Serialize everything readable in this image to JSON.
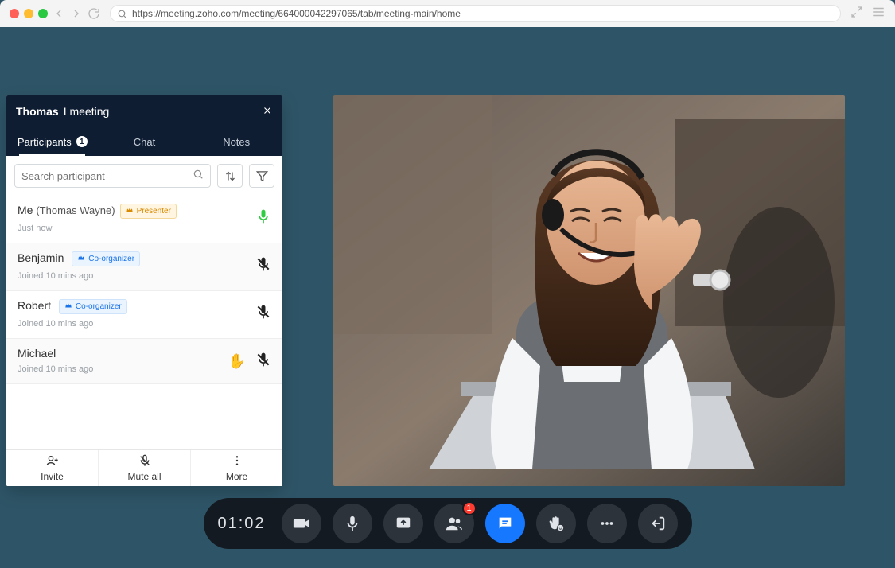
{
  "browser": {
    "url": "https://meeting.zoho.com/meeting/664000042297065/tab/meeting-main/home"
  },
  "panel": {
    "title_primary": "Thomas",
    "title_secondary": "I meeting",
    "tabs": {
      "participants": "Participants",
      "participants_count": "1",
      "chat": "Chat",
      "notes": "Notes"
    },
    "search_placeholder": "Search participant",
    "footer": {
      "invite": "Invite",
      "mute_all": "Mute all",
      "more": "More"
    }
  },
  "participants": [
    {
      "name": "Me",
      "paren": "(Thomas Wayne)",
      "role": "Presenter",
      "role_kind": "presenter",
      "meta": "Just now",
      "mic": "on",
      "hand": false
    },
    {
      "name": "Benjamin",
      "paren": "",
      "role": "Co-organizer",
      "role_kind": "coorg",
      "meta": "Joined 10 mins ago",
      "mic": "off",
      "hand": false
    },
    {
      "name": "Robert",
      "paren": "",
      "role": "Co-organizer",
      "role_kind": "coorg",
      "meta": "Joined 10 mins ago",
      "mic": "off",
      "hand": false
    },
    {
      "name": "Michael",
      "paren": "",
      "role": "",
      "role_kind": "",
      "meta": "Joined 10 mins ago",
      "mic": "off",
      "hand": true
    }
  ],
  "controls": {
    "timer": "01:02",
    "participants_badge": "1"
  }
}
